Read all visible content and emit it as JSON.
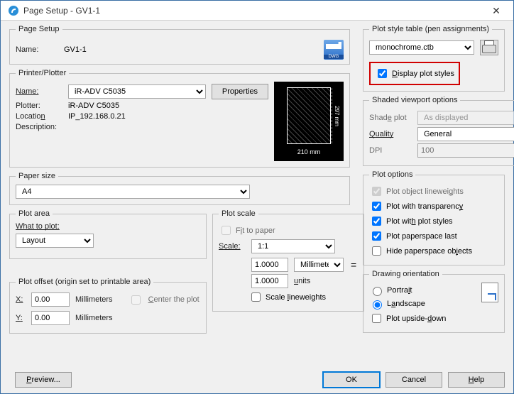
{
  "window": {
    "title": "Page Setup - GV1-1"
  },
  "pageSetup": {
    "legend": "Page Setup",
    "nameLabel": "Name:",
    "name": "GV1-1"
  },
  "printer": {
    "legend": "Printer/Plotter",
    "nameLabel": "Name:",
    "nameValue": "iR-ADV C5035",
    "propertiesBtn": "Properties",
    "plotterLabel": "Plotter:",
    "plotterValue": "iR-ADV C5035",
    "locationLabel": "Location",
    "locationValue": "IP_192.168.0.21",
    "descLabel": "Description:",
    "preview": {
      "width": "210 mm",
      "height": "297 mm"
    }
  },
  "paperSize": {
    "legend": "Paper size",
    "value": "A4"
  },
  "plotArea": {
    "legend": "Plot area",
    "whatLabel": "What to plot:",
    "value": "Layout"
  },
  "plotOffset": {
    "legend": "Plot offset (origin set to printable area)",
    "xLabel": "X:",
    "xValue": "0.00",
    "xUnit": "Millimeters",
    "yLabel": "Y:",
    "yValue": "0.00",
    "yUnit": "Millimeters",
    "centerLabel": "Center the plot"
  },
  "plotScale": {
    "legend": "Plot scale",
    "fitLabel": "Fit to paper",
    "scaleLabel": "Scale:",
    "scaleValue": "1:1",
    "num": "1.0000",
    "numUnit": "Millimeters",
    "den": "1.0000",
    "denUnit": "units",
    "lwLabel": "Scale lineweights"
  },
  "styleTable": {
    "legend": "Plot style table (pen assignments)",
    "value": "monochrome.ctb",
    "displayLabel": "Display plot styles"
  },
  "shaded": {
    "legend": "Shaded viewport options",
    "shadeLabel": "Shade plot",
    "shadeValue": "As displayed",
    "qualityLabel": "Quality",
    "qualityValue": "General",
    "dpiLabel": "DPI",
    "dpiValue": "100"
  },
  "plotOptions": {
    "legend": "Plot options",
    "o1": "Plot object lineweights",
    "o2": "Plot with transparency",
    "o3": "Plot with plot styles",
    "o4": "Plot paperspace last",
    "o5": "Hide paperspace objects"
  },
  "orientation": {
    "legend": "Drawing orientation",
    "portrait": "Portrait",
    "landscape": "Landscape",
    "upside": "Plot upside-down"
  },
  "footer": {
    "preview": "Preview...",
    "ok": "OK",
    "cancel": "Cancel",
    "help": "Help"
  }
}
